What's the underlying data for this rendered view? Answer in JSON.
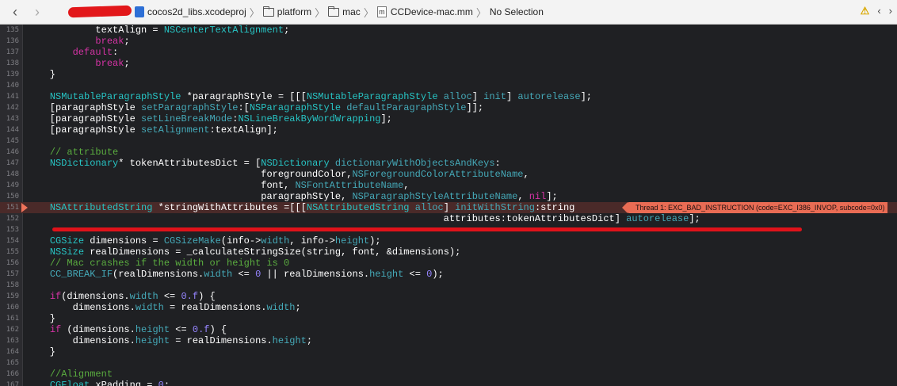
{
  "breadcrumb": {
    "project": "cocos2d_libs.xcodeproj",
    "folder1": "platform",
    "folder2": "mac",
    "file": "CCDevice-mac.mm",
    "selection": "No Selection"
  },
  "error": {
    "badge": "Thread 1: EXC_BAD_INSTRUCTION (code=EXC_I386_INVOP, subcode=0x0)"
  },
  "lines": [
    {
      "n": "135",
      "t": "            textAlign = NSCenterTextAlignment;"
    },
    {
      "n": "136",
      "t": "            break;"
    },
    {
      "n": "137",
      "t": "        default:"
    },
    {
      "n": "138",
      "t": "            break;"
    },
    {
      "n": "139",
      "t": "    }"
    },
    {
      "n": "140",
      "t": ""
    },
    {
      "n": "141",
      "t": "    NSMutableParagraphStyle *paragraphStyle = [[[NSMutableParagraphStyle alloc] init] autorelease];"
    },
    {
      "n": "142",
      "t": "    [paragraphStyle setParagraphStyle:[NSParagraphStyle defaultParagraphStyle]];"
    },
    {
      "n": "143",
      "t": "    [paragraphStyle setLineBreakMode:NSLineBreakByWordWrapping];"
    },
    {
      "n": "144",
      "t": "    [paragraphStyle setAlignment:textAlign];"
    },
    {
      "n": "145",
      "t": ""
    },
    {
      "n": "146",
      "t": "    // attribute"
    },
    {
      "n": "147",
      "t": "    NSDictionary* tokenAttributesDict = [NSDictionary dictionaryWithObjectsAndKeys:"
    },
    {
      "n": "148",
      "t": "                                         foregroundColor,NSForegroundColorAttributeName,"
    },
    {
      "n": "149",
      "t": "                                         font, NSFontAttributeName,"
    },
    {
      "n": "150",
      "t": "                                         paragraphStyle, NSParagraphStyleAttributeName, nil];"
    },
    {
      "n": "151",
      "t": "    NSAttributedString *stringWithAttributes =[[[NSAttributedString alloc] initWithString:string"
    },
    {
      "n": "152",
      "t": "                                                                         attributes:tokenAttributesDict] autorelease];"
    },
    {
      "n": "153",
      "t": ""
    },
    {
      "n": "154",
      "t": "    CGSize dimensions = CGSizeMake(info->width, info->height);"
    },
    {
      "n": "155",
      "t": "    NSSize realDimensions = _calculateStringSize(string, font, &dimensions);"
    },
    {
      "n": "156",
      "t": "    // Mac crashes if the width or height is 0"
    },
    {
      "n": "157",
      "t": "    CC_BREAK_IF(realDimensions.width <= 0 || realDimensions.height <= 0);"
    },
    {
      "n": "158",
      "t": ""
    },
    {
      "n": "159",
      "t": "    if(dimensions.width <= 0.f) {"
    },
    {
      "n": "160",
      "t": "        dimensions.width = realDimensions.width;"
    },
    {
      "n": "161",
      "t": "    }"
    },
    {
      "n": "162",
      "t": "    if (dimensions.height <= 0.f) {"
    },
    {
      "n": "163",
      "t": "        dimensions.height = realDimensions.height;"
    },
    {
      "n": "164",
      "t": "    }"
    },
    {
      "n": "165",
      "t": ""
    },
    {
      "n": "166",
      "t": "    //Alignment"
    },
    {
      "n": "167",
      "t": "    CGFloat xPadding = 0;"
    }
  ]
}
